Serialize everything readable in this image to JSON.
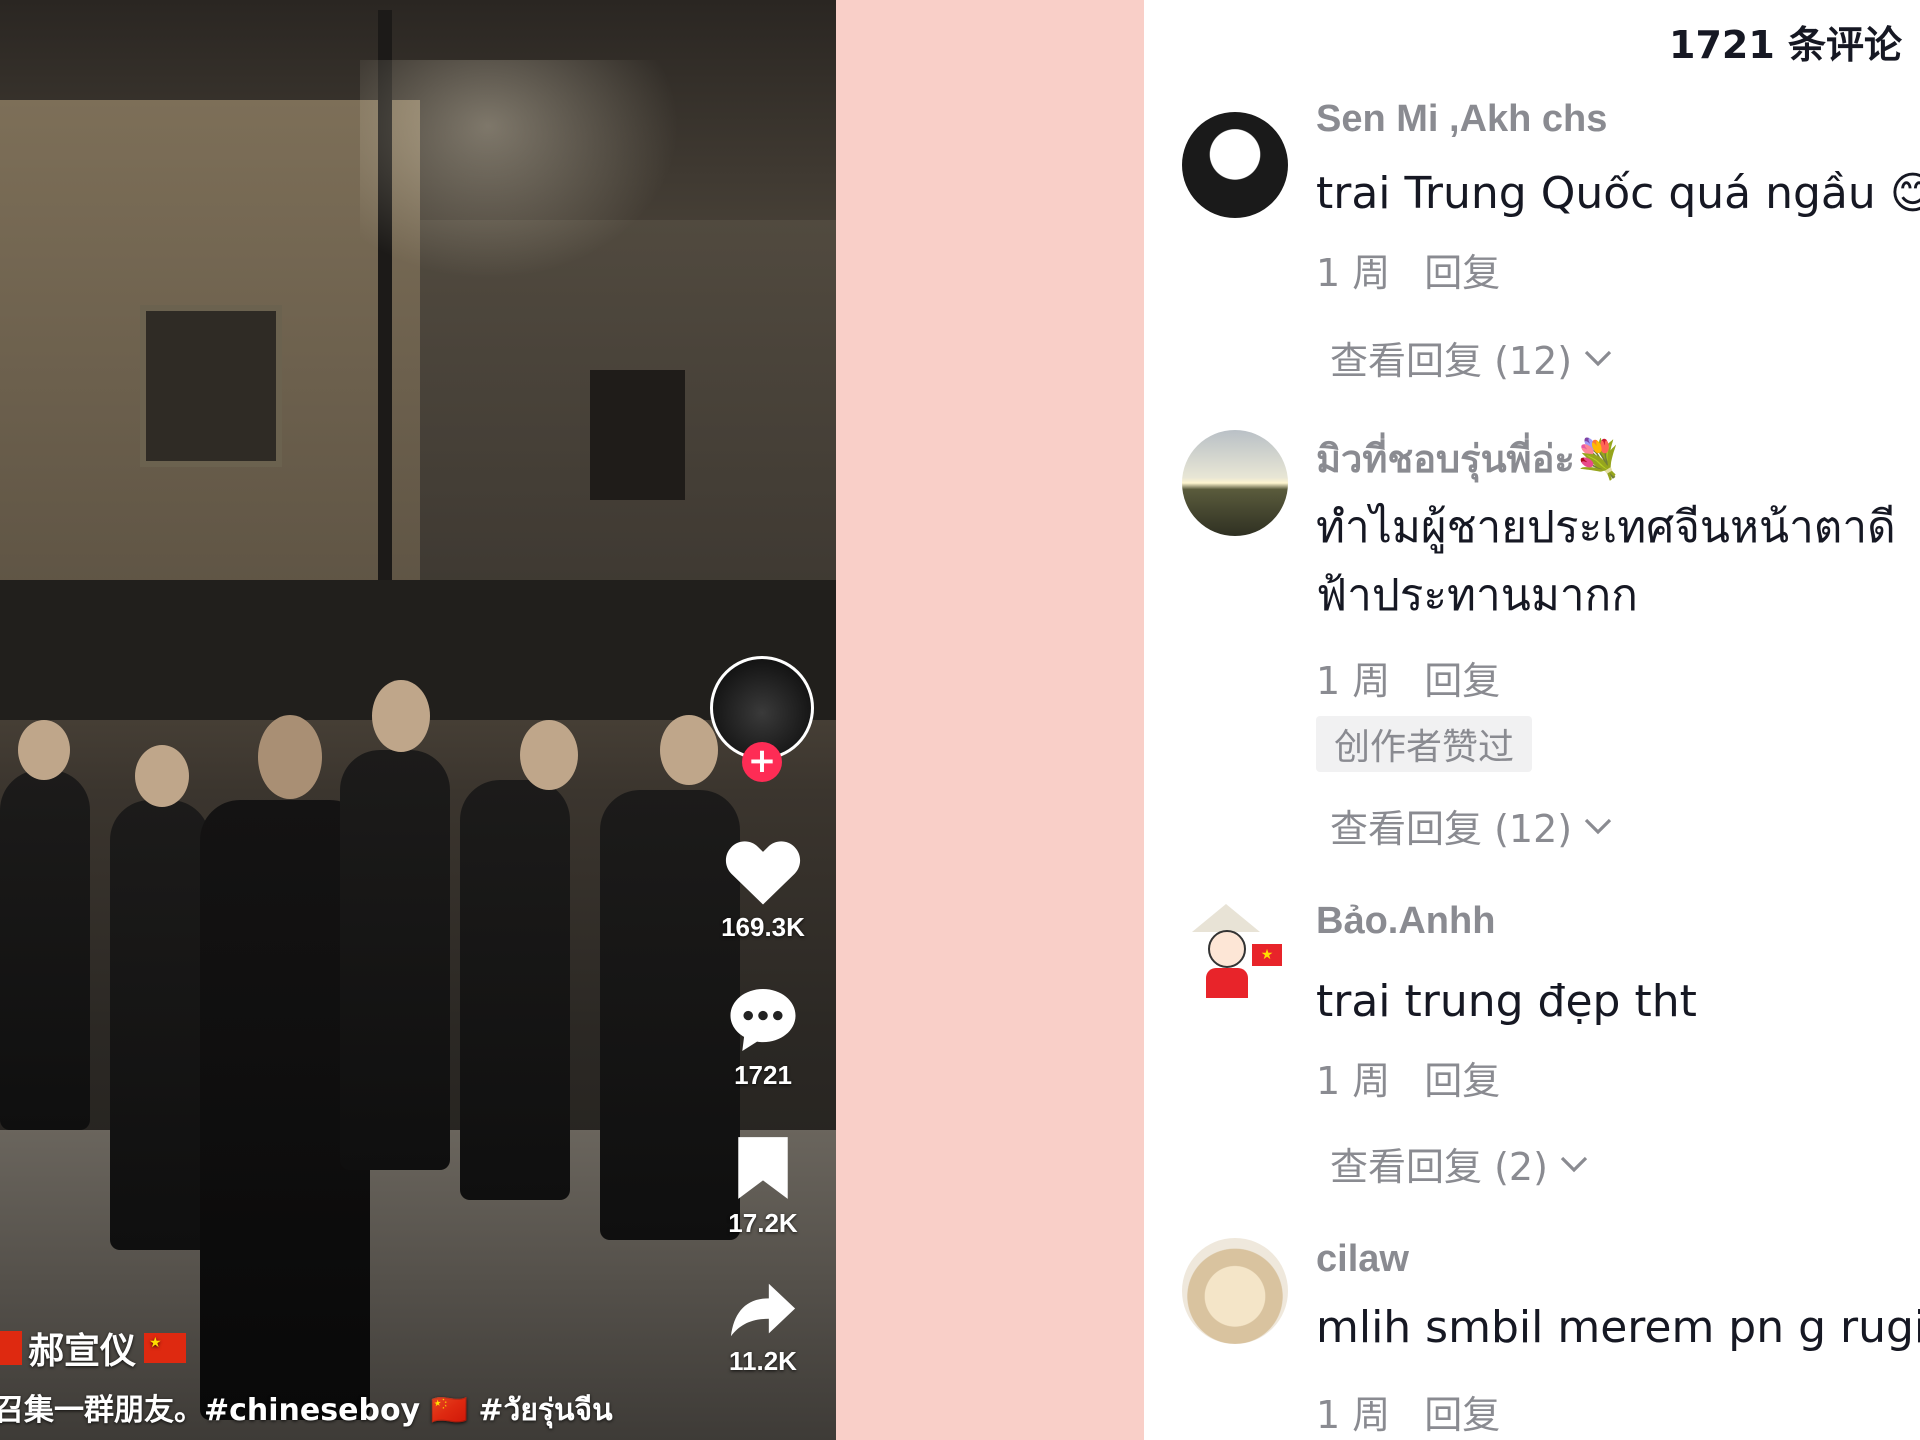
{
  "video": {
    "username": "郝宣仪",
    "caption": "召集一群朋友。#chineseboy 🇨🇳 #วัยรุ่นจีน",
    "likes": "169.3K",
    "comments": "1721",
    "saves": "17.2K",
    "shares": "11.2K",
    "icons": [
      "follow-plus-icon",
      "heart-icon",
      "comment-icon",
      "bookmark-icon",
      "share-icon",
      "china-flag-icon"
    ]
  },
  "comments_panel": {
    "title": "1721 条评论",
    "items": [
      {
        "username": "Sen Mi ,Akh chs",
        "text": "trai Trung Quốc quá ngầu 😊",
        "time": "1 周",
        "reply": "回复",
        "view_replies": "查看回复 (12)"
      },
      {
        "username": "มิวที่ชอบรุ่นพี่อ่ะ💐",
        "text": "ทำไมผู้ชายประเทศจีนหน้าตาดี",
        "text2": "ฟ้าประทานมากก",
        "time": "1 周",
        "reply": "回复",
        "badge": "创作者赞过",
        "view_replies": "查看回复 (12)"
      },
      {
        "username": "Bảo.Anhh",
        "text": "trai trung đẹp tht",
        "time": "1 周",
        "reply": "回复",
        "view_replies": "查看回复 (2)"
      },
      {
        "username": "cilaw",
        "text": "mlih smbil merem pn g rugi😂",
        "time": "1 周",
        "reply": "回复"
      }
    ]
  },
  "colors": {
    "accent": "#fe2c55",
    "page_bg": "#f9cfc8",
    "text_primary": "#161823",
    "text_secondary": "#8a8b91"
  }
}
